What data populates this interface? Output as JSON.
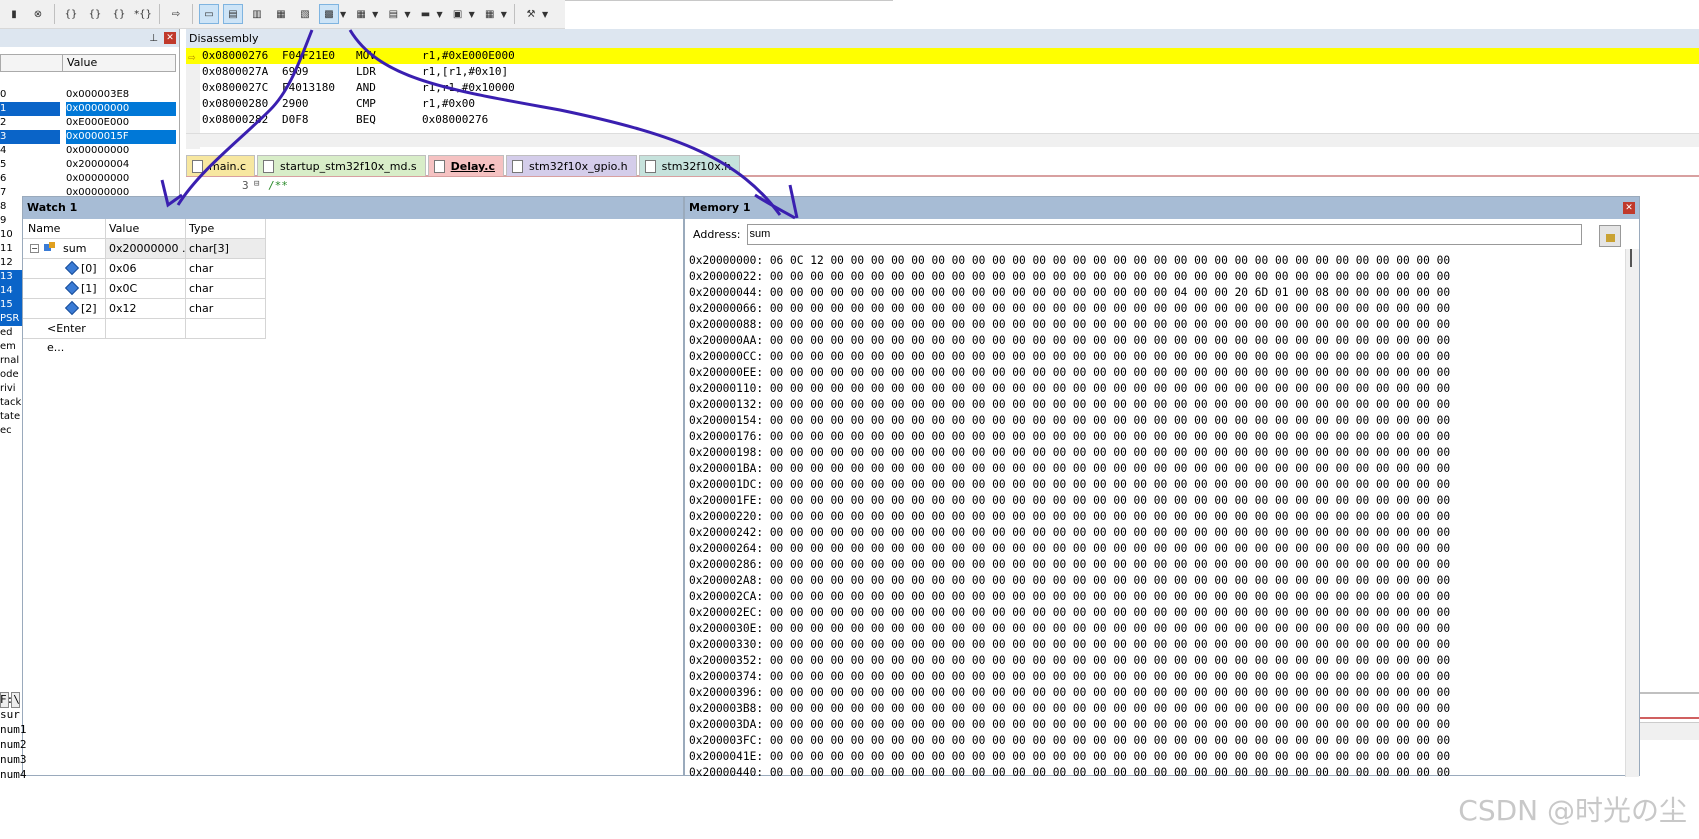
{
  "disassembly": {
    "title": "Disassembly",
    "rows": [
      {
        "addr": "0x08000276",
        "code": "F04F21E0",
        "mnemonic": "MOV",
        "operands": "r1,#0xE000E000",
        "current": true
      },
      {
        "addr": "0x0800027A",
        "code": "6909",
        "mnemonic": "LDR",
        "operands": "r1,[r1,#0x10]"
      },
      {
        "addr": "0x0800027C",
        "code": "F4013180",
        "mnemonic": "AND",
        "operands": "r1,r1,#0x10000"
      },
      {
        "addr": "0x08000280",
        "code": "2900",
        "mnemonic": "CMP",
        "operands": "r1,#0x00"
      },
      {
        "addr": "0x08000282",
        "code": "D0F8",
        "mnemonic": "BEQ",
        "operands": "0x08000276"
      }
    ]
  },
  "registers": {
    "value_header": "Value",
    "rows": [
      {
        "name": "0",
        "value": "0x000003E8"
      },
      {
        "name": "1",
        "value": "0x00000000",
        "selected": true
      },
      {
        "name": "2",
        "value": "0xE000E000"
      },
      {
        "name": "3",
        "value": "0x0000015F",
        "selected": true
      },
      {
        "name": "4",
        "value": "0x00000000"
      },
      {
        "name": "5",
        "value": "0x20000004"
      },
      {
        "name": "6",
        "value": "0x00000000"
      },
      {
        "name": "7",
        "value": "0x00000000"
      }
    ],
    "more_names": [
      "8",
      "9",
      "10",
      "11",
      "12",
      "13",
      "14",
      "15",
      "PSR",
      "ed",
      "em",
      "rnal",
      "ode",
      "rivi",
      "tack",
      "tate",
      "ec"
    ]
  },
  "tabs": [
    {
      "label": "main.c"
    },
    {
      "label": "startup_stm32f10x_md.s"
    },
    {
      "label": "Delay.c",
      "active": true
    },
    {
      "label": "stm32f10x_gpio.h"
    },
    {
      "label": "stm32f10x.h"
    }
  ],
  "editor": {
    "line_no": "3",
    "text": "/**"
  },
  "watch": {
    "title": "Watch 1",
    "headers": {
      "name": "Name",
      "value": "Value",
      "type": "Type"
    },
    "rows": [
      {
        "name": "sum",
        "value": "0x20000000 ...",
        "type": "char[3]"
      },
      {
        "name": "[0]",
        "value": "0x06",
        "type": "char"
      },
      {
        "name": "[1]",
        "value": "0x0C",
        "type": "char"
      },
      {
        "name": "[2]",
        "value": "0x12",
        "type": "char"
      }
    ],
    "enter_placeholder": "<Enter e..."
  },
  "memory": {
    "title": "Memory 1",
    "address_label": "Address:",
    "address_value": "sum",
    "lines": [
      "0x20000000: 06 0C 12 00 00 00 00 00 00 00 00 00 00 00 00 00 00 00 00 00 00 00 00 00 00 00 00 00 00 00 00 00 00 00",
      "0x20000022: 00 00 00 00 00 00 00 00 00 00 00 00 00 00 00 00 00 00 00 00 00 00 00 00 00 00 00 00 00 00 00 00 00 00",
      "0x20000044: 00 00 00 00 00 00 00 00 00 00 00 00 00 00 00 00 00 00 00 00 04 00 00 20 6D 01 00 08 00 00 00 00 00 00",
      "0x20000066: 00 00 00 00 00 00 00 00 00 00 00 00 00 00 00 00 00 00 00 00 00 00 00 00 00 00 00 00 00 00 00 00 00 00",
      "0x20000088: 00 00 00 00 00 00 00 00 00 00 00 00 00 00 00 00 00 00 00 00 00 00 00 00 00 00 00 00 00 00 00 00 00 00",
      "0x200000AA: 00 00 00 00 00 00 00 00 00 00 00 00 00 00 00 00 00 00 00 00 00 00 00 00 00 00 00 00 00 00 00 00 00 00",
      "0x200000CC: 00 00 00 00 00 00 00 00 00 00 00 00 00 00 00 00 00 00 00 00 00 00 00 00 00 00 00 00 00 00 00 00 00 00",
      "0x200000EE: 00 00 00 00 00 00 00 00 00 00 00 00 00 00 00 00 00 00 00 00 00 00 00 00 00 00 00 00 00 00 00 00 00 00",
      "0x20000110: 00 00 00 00 00 00 00 00 00 00 00 00 00 00 00 00 00 00 00 00 00 00 00 00 00 00 00 00 00 00 00 00 00 00",
      "0x20000132: 00 00 00 00 00 00 00 00 00 00 00 00 00 00 00 00 00 00 00 00 00 00 00 00 00 00 00 00 00 00 00 00 00 00",
      "0x20000154: 00 00 00 00 00 00 00 00 00 00 00 00 00 00 00 00 00 00 00 00 00 00 00 00 00 00 00 00 00 00 00 00 00 00",
      "0x20000176: 00 00 00 00 00 00 00 00 00 00 00 00 00 00 00 00 00 00 00 00 00 00 00 00 00 00 00 00 00 00 00 00 00 00",
      "0x20000198: 00 00 00 00 00 00 00 00 00 00 00 00 00 00 00 00 00 00 00 00 00 00 00 00 00 00 00 00 00 00 00 00 00 00",
      "0x200001BA: 00 00 00 00 00 00 00 00 00 00 00 00 00 00 00 00 00 00 00 00 00 00 00 00 00 00 00 00 00 00 00 00 00 00",
      "0x200001DC: 00 00 00 00 00 00 00 00 00 00 00 00 00 00 00 00 00 00 00 00 00 00 00 00 00 00 00 00 00 00 00 00 00 00",
      "0x200001FE: 00 00 00 00 00 00 00 00 00 00 00 00 00 00 00 00 00 00 00 00 00 00 00 00 00 00 00 00 00 00 00 00 00 00",
      "0x20000220: 00 00 00 00 00 00 00 00 00 00 00 00 00 00 00 00 00 00 00 00 00 00 00 00 00 00 00 00 00 00 00 00 00 00",
      "0x20000242: 00 00 00 00 00 00 00 00 00 00 00 00 00 00 00 00 00 00 00 00 00 00 00 00 00 00 00 00 00 00 00 00 00 00",
      "0x20000264: 00 00 00 00 00 00 00 00 00 00 00 00 00 00 00 00 00 00 00 00 00 00 00 00 00 00 00 00 00 00 00 00 00 00",
      "0x20000286: 00 00 00 00 00 00 00 00 00 00 00 00 00 00 00 00 00 00 00 00 00 00 00 00 00 00 00 00 00 00 00 00 00 00",
      "0x200002A8: 00 00 00 00 00 00 00 00 00 00 00 00 00 00 00 00 00 00 00 00 00 00 00 00 00 00 00 00 00 00 00 00 00 00",
      "0x200002CA: 00 00 00 00 00 00 00 00 00 00 00 00 00 00 00 00 00 00 00 00 00 00 00 00 00 00 00 00 00 00 00 00 00 00",
      "0x200002EC: 00 00 00 00 00 00 00 00 00 00 00 00 00 00 00 00 00 00 00 00 00 00 00 00 00 00 00 00 00 00 00 00 00 00",
      "0x2000030E: 00 00 00 00 00 00 00 00 00 00 00 00 00 00 00 00 00 00 00 00 00 00 00 00 00 00 00 00 00 00 00 00 00 00",
      "0x20000330: 00 00 00 00 00 00 00 00 00 00 00 00 00 00 00 00 00 00 00 00 00 00 00 00 00 00 00 00 00 00 00 00 00 00",
      "0x20000352: 00 00 00 00 00 00 00 00 00 00 00 00 00 00 00 00 00 00 00 00 00 00 00 00 00 00 00 00 00 00 00 00 00 00",
      "0x20000374: 00 00 00 00 00 00 00 00 00 00 00 00 00 00 00 00 00 00 00 00 00 00 00 00 00 00 00 00 00 00 00 00 00 00",
      "0x20000396: 00 00 00 00 00 00 00 00 00 00 00 00 00 00 00 00 00 00 00 00 00 00 00 00 00 00 00 00 00 00 00 00 00 00",
      "0x200003B8: 00 00 00 00 00 00 00 00 00 00 00 00 00 00 00 00 00 00 00 00 00 00 00 00 00 00 00 00 00 00 00 00 00 00",
      "0x200003DA: 00 00 00 00 00 00 00 00 00 00 00 00 00 00 00 00 00 00 00 00 00 00 00 00 00 00 00 00 00 00 00 00 00 00",
      "0x200003FC: 00 00 00 00 00 00 00 00 00 00 00 00 00 00 00 00 00 00 00 00 00 00 00 00 00 00 00 00 00 00 00 00 00 00",
      "0x2000041E: 00 00 00 00 00 00 00 00 00 00 00 00 00 00 00 00 00 00 00 00 00 00 00 00 00 00 00 00 00 00 00 00 00 00",
      "0x20000440: 00 00 00 00 00 00 00 00 00 00 00 00 00 00 00 00 00 00 00 00 00 00 00 00 00 00 00 00 00 00 00 00 00 00"
    ]
  },
  "output": {
    "lines": [
      "F:\\",
      "sur",
      "num1",
      "num2",
      "num3",
      "num4"
    ]
  },
  "watermark": "CSDN @时光の尘",
  "colors": {
    "current_line": "#ffff00",
    "selection": "#0078d7",
    "annotation_ink": "#3a1fb0"
  }
}
